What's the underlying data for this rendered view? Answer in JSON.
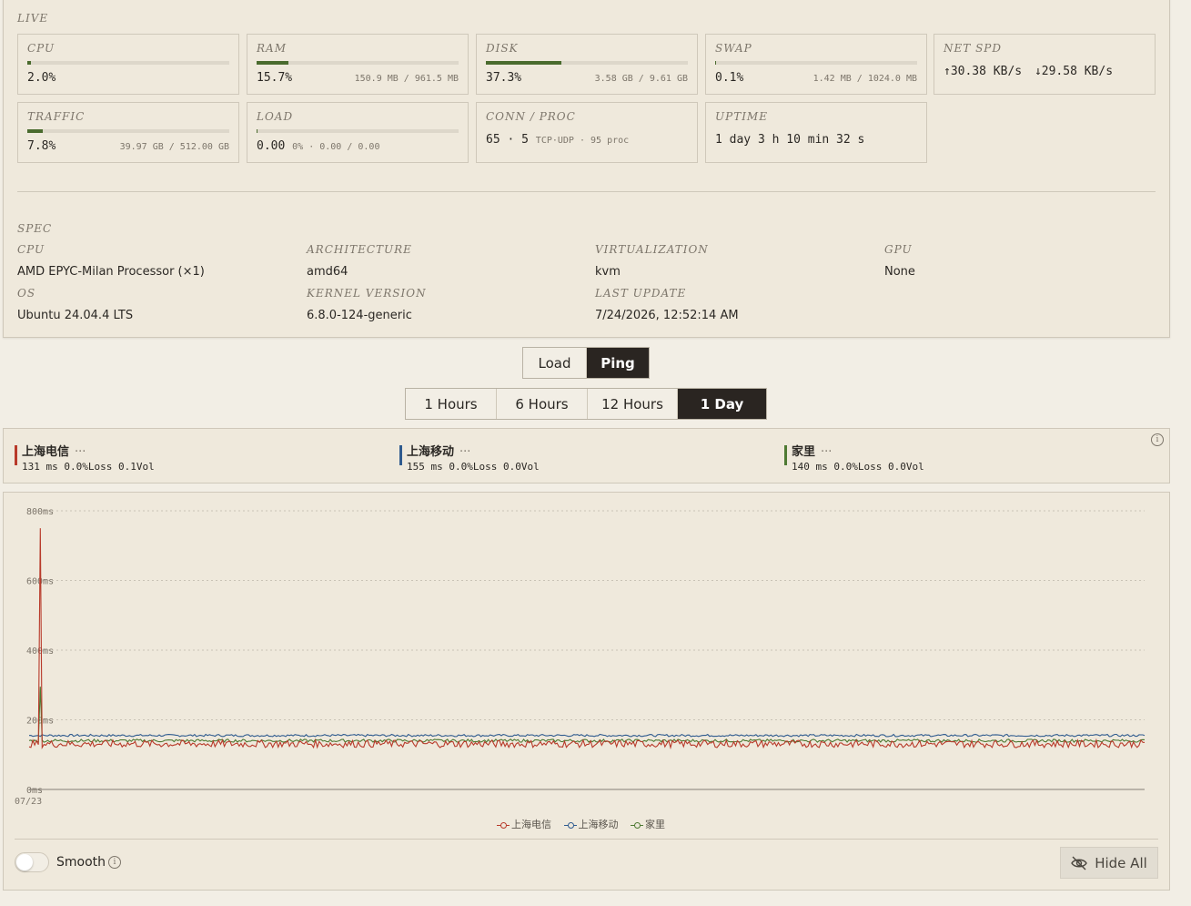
{
  "live": {
    "title": "LIVE",
    "cards": {
      "cpu": {
        "label": "CPU",
        "value": "2.0%",
        "percent": 2.0
      },
      "ram": {
        "label": "RAM",
        "value": "15.7%",
        "percent": 15.7,
        "detail": "150.9 MB / 961.5 MB"
      },
      "disk": {
        "label": "DISK",
        "value": "37.3%",
        "percent": 37.3,
        "detail": "3.58 GB / 9.61 GB"
      },
      "swap": {
        "label": "SWAP",
        "value": "0.1%",
        "percent": 0.1,
        "detail": "1.42 MB / 1024.0 MB"
      },
      "net": {
        "label": "NET SPD",
        "up": "30.38 KB/s",
        "down": "29.58 KB/s"
      },
      "traffic": {
        "label": "TRAFFIC",
        "value": "7.8%",
        "percent": 7.8,
        "detail": "39.97 GB / 512.00 GB"
      },
      "load": {
        "label": "LOAD",
        "value": "0.00",
        "percent": 0,
        "detail": "0% · 0.00 / 0.00"
      },
      "conn": {
        "label": "CONN / PROC",
        "conn_value": "65 · 5",
        "detail": "TCP·UDP · 95 proc"
      },
      "uptime": {
        "label": "UPTIME",
        "value": "1 day 3 h 10 min 32 s"
      }
    }
  },
  "spec": {
    "title": "SPEC",
    "cpu": {
      "label": "CPU",
      "value": "AMD EPYC-Milan Processor (×1)"
    },
    "architecture": {
      "label": "ARCHITECTURE",
      "value": "amd64"
    },
    "virtualization": {
      "label": "VIRTUALIZATION",
      "value": "kvm"
    },
    "gpu": {
      "label": "GPU",
      "value": "None"
    },
    "os": {
      "label": "OS",
      "value": "Ubuntu 24.04.4 LTS"
    },
    "kernel": {
      "label": "KERNEL VERSION",
      "value": "6.8.0-124-generic"
    },
    "last_update": {
      "label": "LAST UPDATE",
      "value": "7/24/2026, 12:52:14 AM"
    }
  },
  "view_toggle": {
    "load": "Load",
    "ping": "Ping",
    "active": "ping"
  },
  "range_toggle": {
    "h1": "1 Hours",
    "h6": "6 Hours",
    "h12": "12 Hours",
    "d1": "1 Day",
    "active": "d1"
  },
  "ping_targets": [
    {
      "name": "上海电信",
      "dots": "···",
      "stats": "131 ms 0.0%Loss 0.1Vol",
      "color": "#b83a2a"
    },
    {
      "name": "上海移动",
      "dots": "···",
      "stats": "155 ms 0.0%Loss 0.0Vol",
      "color": "#2f5b8f"
    },
    {
      "name": "家里",
      "dots": "···",
      "stats": "140 ms 0.0%Loss 0.0Vol",
      "color": "#4e7a33"
    }
  ],
  "chart_data": {
    "type": "line",
    "y_ticks": [
      "800ms",
      "600ms",
      "400ms",
      "200ms",
      "0ms"
    ],
    "ylim": [
      0,
      800
    ],
    "x_ticks": [
      "07/23"
    ],
    "grid": true,
    "legend_position": "bottom-center",
    "series": [
      {
        "name": "上海电信",
        "color": "#b83a2a",
        "baseline": 131,
        "spike_value": 750
      },
      {
        "name": "上海移动",
        "color": "#2f5b8f",
        "baseline": 155,
        "spike_value": 155
      },
      {
        "name": "家里",
        "color": "#4e7a33",
        "baseline": 140,
        "spike_value": 295
      }
    ]
  },
  "controls": {
    "smooth_label": "Smooth",
    "hide_all_label": "Hide All",
    "info_glyph": "i"
  }
}
